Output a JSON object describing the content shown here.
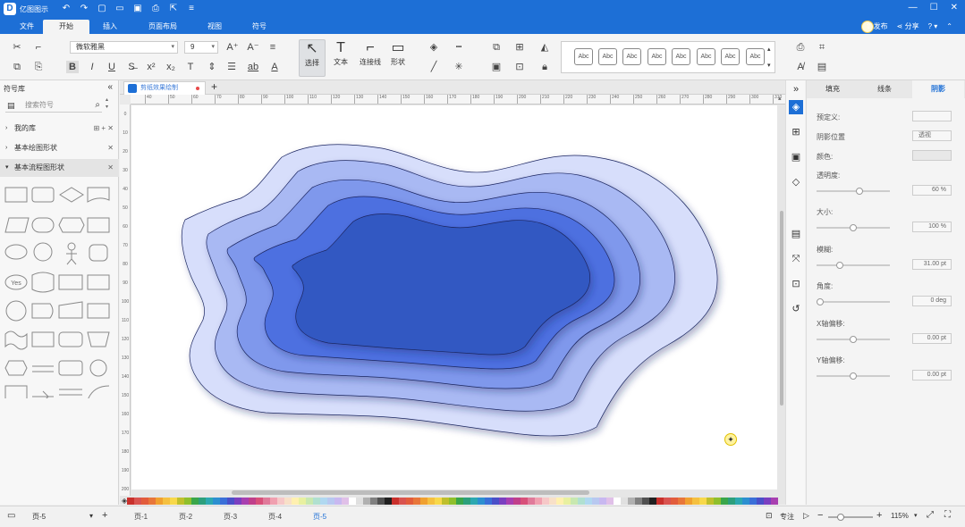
{
  "app": {
    "name": "亿图图示"
  },
  "ribbon": {
    "tabs": [
      "文件",
      "开始",
      "插入",
      "页面布局",
      "视图",
      "符号"
    ],
    "active": "开始",
    "publish": "发布",
    "share": "分享",
    "help": "?"
  },
  "toolbar": {
    "font_name": "微软雅黑",
    "font_size": "9",
    "tools": [
      {
        "label": "选择"
      },
      {
        "label": "文本"
      },
      {
        "label": "连接线"
      },
      {
        "label": "形状"
      }
    ],
    "style_label": "Abc"
  },
  "library": {
    "title": "符号库",
    "search_placeholder": "搜索符号",
    "sections": [
      {
        "label": "我的库",
        "expanded": false
      },
      {
        "label": "基本绘图形状",
        "expanded": false
      },
      {
        "label": "基本流程图形状",
        "expanded": true
      }
    ]
  },
  "document": {
    "tab_title": "剪纸效果绘制"
  },
  "ruler": {
    "h_labels": [
      "40",
      "50",
      "60",
      "70",
      "80",
      "90",
      "100",
      "110",
      "120",
      "130",
      "140",
      "150",
      "160",
      "170",
      "180",
      "190",
      "200",
      "210",
      "220",
      "230",
      "240",
      "250",
      "260",
      "270",
      "280",
      "290",
      "300",
      "310"
    ],
    "v_labels": [
      "0",
      "10",
      "20",
      "30",
      "40",
      "50",
      "60",
      "70",
      "80",
      "90",
      "100",
      "110",
      "120",
      "130",
      "140",
      "150",
      "160",
      "170",
      "180",
      "190",
      "200"
    ]
  },
  "canvas": {
    "layer_colors": [
      "#d7defb",
      "#a9b9f3",
      "#7f98ec",
      "#4d6fe0",
      "#3258c2"
    ]
  },
  "properties": {
    "tabs": [
      "填充",
      "线条",
      "阴影"
    ],
    "active_tab": "阴影",
    "rows": [
      {
        "label": "预定义:",
        "value": "",
        "level": null
      },
      {
        "label": "阴影位置",
        "value": "透视",
        "level": null
      },
      {
        "label": "颜色:",
        "value": "",
        "level": null
      },
      {
        "label": "透明度:",
        "value": "60 %",
        "level": 0.6
      },
      {
        "label": "大小:",
        "value": "100 %",
        "level": 0.5
      },
      {
        "label": "模糊:",
        "value": "31.00 pt",
        "level": 0.3
      },
      {
        "label": "角度:",
        "value": "0 deg",
        "level": 0.0
      },
      {
        "label": "X轴偏移:",
        "value": "0.00 pt",
        "level": 0.5
      },
      {
        "label": "Y轴偏移:",
        "value": "0.00 pt",
        "level": 0.5
      }
    ]
  },
  "statusbar": {
    "page_selector": "页-5",
    "pages": [
      "页-1",
      "页-2",
      "页-3",
      "页-4",
      "页-5"
    ],
    "active_page": "页-5",
    "focus": "专注",
    "zoom": "115%"
  },
  "palette": [
    "#c9302c",
    "#d9534f",
    "#e25c3c",
    "#e8763a",
    "#f0a030",
    "#f5c040",
    "#f8d84a",
    "#bfbf2c",
    "#8fbf2c",
    "#3aa64a",
    "#2c9f7c",
    "#2ca8b0",
    "#2c8fd0",
    "#3a6fd8",
    "#4a4fc8",
    "#7a3fc0",
    "#a83fb0",
    "#c03f8a",
    "#d8507a",
    "#e07a9a",
    "#f0a0b0",
    "#f6c8c8",
    "#f8e0c8",
    "#fff0b0",
    "#e8f0a0",
    "#c8e8b0",
    "#b0e0d0",
    "#b0d8f0",
    "#b8c8f0",
    "#c8b8f0",
    "#e0c0e8",
    "#ffffff",
    "#e0e0e0",
    "#b0b0b0",
    "#808080",
    "#505050",
    "#202020"
  ]
}
